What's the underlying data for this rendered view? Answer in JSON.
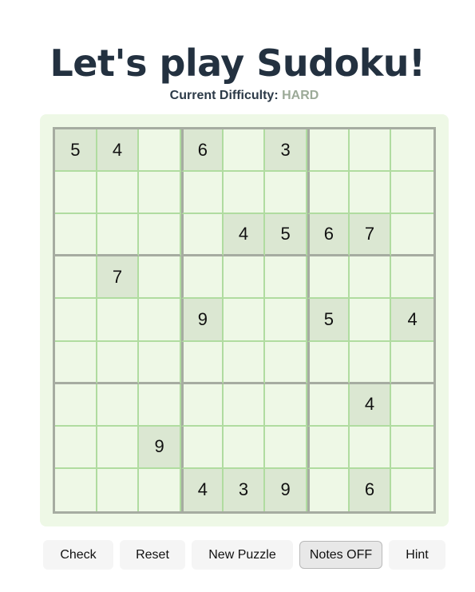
{
  "title": "Let's play Sudoku!",
  "difficulty": {
    "label": "Current Difficulty:",
    "value": "HARD"
  },
  "board": {
    "cells": [
      [
        "5",
        "4",
        "",
        "6",
        "",
        "3",
        "",
        "",
        ""
      ],
      [
        "",
        "",
        "",
        "",
        "",
        "",
        "",
        "",
        ""
      ],
      [
        "",
        "",
        "",
        "",
        "4",
        "5",
        "6",
        "7",
        ""
      ],
      [
        "",
        "7",
        "",
        "",
        "",
        "",
        "",
        "",
        ""
      ],
      [
        "",
        "",
        "",
        "9",
        "",
        "",
        "5",
        "",
        "4"
      ],
      [
        "",
        "",
        "",
        "",
        "",
        "",
        "",
        "",
        ""
      ],
      [
        "",
        "",
        "",
        "",
        "",
        "",
        "",
        "4",
        ""
      ],
      [
        "",
        "",
        "9",
        "",
        "",
        "",
        "",
        "",
        ""
      ],
      [
        "",
        "",
        "",
        "4",
        "3",
        "9",
        "",
        "6",
        ""
      ]
    ]
  },
  "controls": {
    "check": "Check",
    "reset": "Reset",
    "new_puzzle": "New Puzzle",
    "notes": "Notes OFF",
    "hint": "Hint"
  },
  "colors": {
    "title": "#233140",
    "difficulty_level": "#9caa98",
    "board_background": "#eef8e6",
    "given_cell": "#dbe7d2",
    "grid_line": "#b0dca0",
    "box_line": "#a6aca1"
  }
}
